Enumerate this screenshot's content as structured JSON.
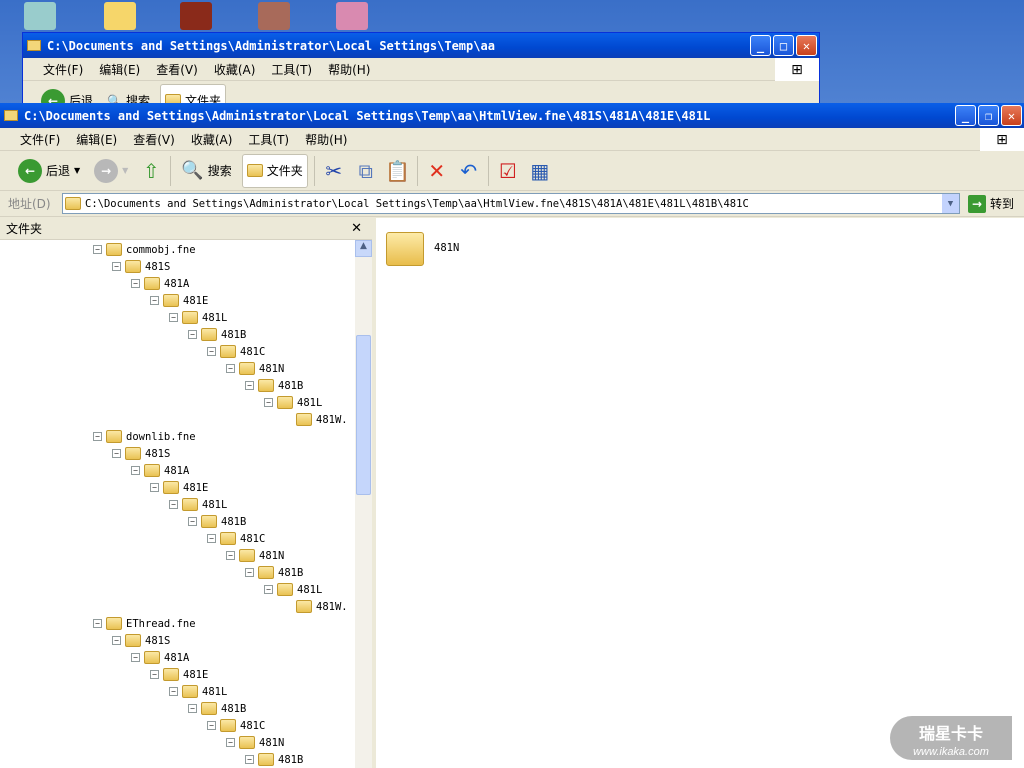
{
  "back_window": {
    "title": "C:\\Documents and Settings\\Administrator\\Local Settings\\Temp\\aa",
    "menu": [
      "文件(F)",
      "编辑(E)",
      "查看(V)",
      "收藏(A)",
      "工具(T)",
      "帮助(H)"
    ],
    "toolbar": {
      "back": "后退",
      "search": "搜索",
      "folders": "文件夹"
    }
  },
  "window": {
    "title": "C:\\Documents and Settings\\Administrator\\Local Settings\\Temp\\aa\\HtmlView.fne\\481S\\481A\\481E\\481L",
    "menu": [
      "文件(F)",
      "编辑(E)",
      "查看(V)",
      "收藏(A)",
      "工具(T)",
      "帮助(H)"
    ],
    "toolbar": {
      "back": "后退",
      "search": "搜索",
      "folders": "文件夹"
    },
    "address": {
      "label": "地址(D)",
      "value": "C:\\Documents and Settings\\Administrator\\Local Settings\\Temp\\aa\\HtmlView.fne\\481S\\481A\\481E\\481L\\481B\\481C",
      "go": "转到"
    },
    "folders_pane": {
      "title": "文件夹"
    },
    "tree": [
      {
        "name": "commobj.fne",
        "children": [
          "481S",
          "481A",
          "481E",
          "481L",
          "481B",
          "481C",
          "481N",
          "481B",
          "481L",
          "481W."
        ]
      },
      {
        "name": "downlib.fne",
        "children": [
          "481S",
          "481A",
          "481E",
          "481L",
          "481B",
          "481C",
          "481N",
          "481B",
          "481L",
          "481W."
        ]
      },
      {
        "name": "EThread.fne",
        "children": [
          "481S",
          "481A",
          "481E",
          "481L",
          "481B",
          "481C",
          "481N",
          "481B"
        ]
      }
    ],
    "content": [
      {
        "name": "481N"
      }
    ]
  },
  "watermark": {
    "title": "瑞星卡卡",
    "url": "www.ikaka.com"
  }
}
